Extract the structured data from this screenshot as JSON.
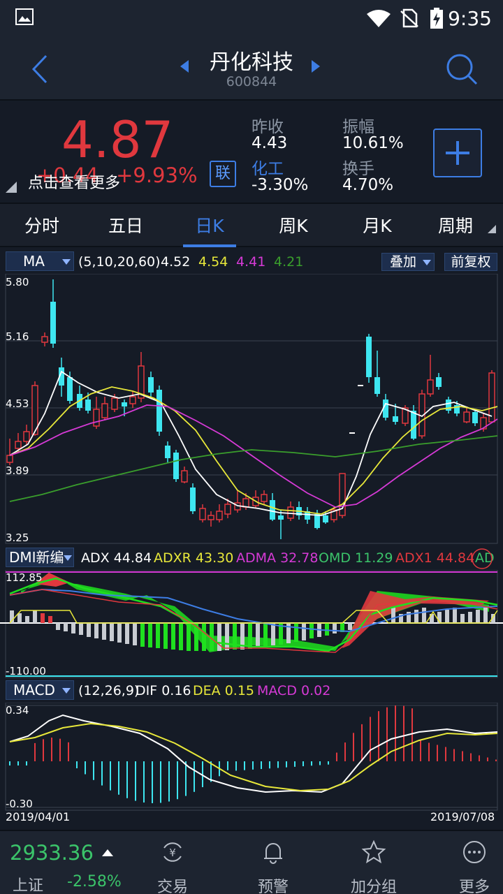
{
  "status": {
    "time": "9:35"
  },
  "header": {
    "title": "丹化科技",
    "code": "600844"
  },
  "quote": {
    "price": "4.87",
    "change": "+0.44",
    "change_pct": "+9.93%",
    "more_hint": "点击查看更多",
    "badge": "联",
    "prev_close_label": "昨收",
    "prev_close": "4.43",
    "sector_label": "化工",
    "sector_change": "-3.30%",
    "amplitude_label": "振幅",
    "amplitude": "10.61%",
    "turnover_label": "换手",
    "turnover": "4.70%"
  },
  "tabs": [
    "分时",
    "五日",
    "日K",
    "周K",
    "月K",
    "周期"
  ],
  "active_tab": 2,
  "ma": {
    "selector": "MA",
    "params": "(5,10,20,60)",
    "v1": "4.52",
    "v2": "4.54",
    "v3": "4.41",
    "v4": "4.21",
    "overlay_btn": "叠加",
    "adjust_btn": "前复权"
  },
  "price_axis": [
    "5.80",
    "5.16",
    "4.53",
    "3.89",
    "3.25"
  ],
  "dmi": {
    "selector": "DMI新编",
    "adx_label": "ADX",
    "adx": "44.84",
    "adxr_label": "ADXR",
    "adxr": "43.30",
    "adma_label": "ADMA",
    "adma": "32.78",
    "omd_label": "OMD",
    "omd": "11.29",
    "adx1_label": "ADX1",
    "adx1": "44.84",
    "extra": "AD",
    "axis_top": "112.85",
    "axis_bottom": "-110.00"
  },
  "macd": {
    "selector": "MACD",
    "params": "(12,26,9)",
    "dif_label": "DIF",
    "dif": "0.16",
    "dea_label": "DEA",
    "dea": "0.15",
    "macd_label": "MACD",
    "macd": "0.02",
    "axis_top": "0.34",
    "axis_bottom": "-0.30"
  },
  "dates": {
    "start": "2019/04/01",
    "end": "2019/07/08"
  },
  "bottom": {
    "index_value": "2933.36",
    "index_name": "上证",
    "index_pct": "-2.58%",
    "nav": [
      "交易",
      "预警",
      "加分组",
      "更多"
    ]
  },
  "colors": {
    "up": "#e0383e",
    "down": "#3ee6f0",
    "accent": "#3d7de4",
    "ma5": "#ffffff",
    "ma10": "#e8e83a",
    "ma20": "#d63ad6",
    "ma60": "#3a9e2c"
  },
  "icons": [
    "back-arrow-icon",
    "search-icon",
    "plus-icon",
    "trade-icon",
    "bell-icon",
    "star-icon",
    "more-dots-icon"
  ]
}
